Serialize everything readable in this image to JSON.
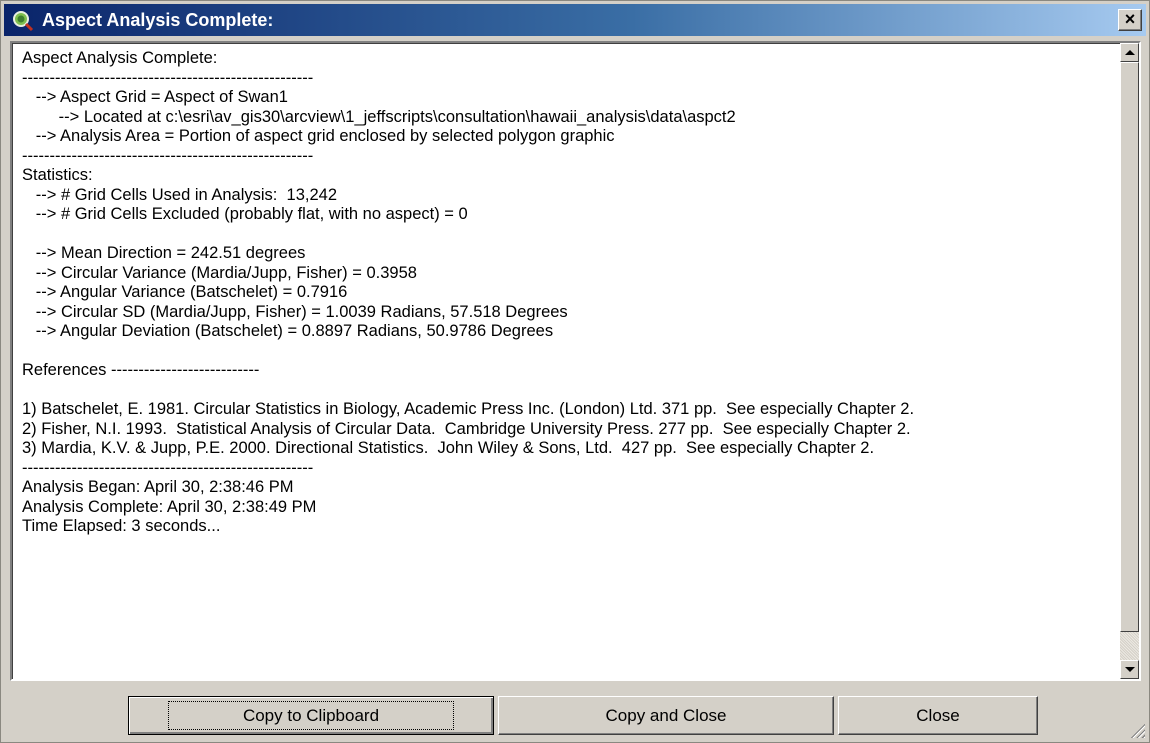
{
  "window": {
    "title": "Aspect Analysis Complete:",
    "close_label": "×",
    "icon": "globe-magnifier-icon"
  },
  "report_lines": [
    "Aspect Analysis Complete:",
    "-----------------------------------------------------",
    "   --> Aspect Grid = Aspect of Swan1",
    "        --> Located at c:\\esri\\av_gis30\\arcview\\1_jeffscripts\\consultation\\hawaii_analysis\\data\\aspct2",
    "   --> Analysis Area = Portion of aspect grid enclosed by selected polygon graphic",
    "-----------------------------------------------------",
    "Statistics:",
    "   --> # Grid Cells Used in Analysis:  13,242",
    "   --> # Grid Cells Excluded (probably flat, with no aspect) = 0",
    "",
    "   --> Mean Direction = 242.51 degrees",
    "   --> Circular Variance (Mardia/Jupp, Fisher) = 0.3958",
    "   --> Angular Variance (Batschelet) = 0.7916",
    "   --> Circular SD (Mardia/Jupp, Fisher) = 1.0039 Radians, 57.518 Degrees",
    "   --> Angular Deviation (Batschelet) = 0.8897 Radians, 50.9786 Degrees",
    "",
    "References ---------------------------",
    "",
    "1) Batschelet, E. 1981. Circular Statistics in Biology, Academic Press Inc. (London) Ltd. 371 pp.  See especially Chapter 2.",
    "2) Fisher, N.I. 1993.  Statistical Analysis of Circular Data.  Cambridge University Press. 277 pp.  See especially Chapter 2.",
    "3) Mardia, K.V. & Jupp, P.E. 2000. Directional Statistics.  John Wiley & Sons, Ltd.  427 pp.  See especially Chapter 2.",
    "-----------------------------------------------------",
    "Analysis Began: April 30, 2:38:46 PM",
    "Analysis Complete: April 30, 2:38:49 PM",
    "Time Elapsed: 3 seconds..."
  ],
  "buttons": {
    "copy_clipboard": "Copy to Clipboard",
    "copy_close": "Copy and Close",
    "close": "Close"
  },
  "colors": {
    "titlebar_start": "#0a246a",
    "titlebar_end": "#a6caf0",
    "face": "#d4d0c8"
  }
}
